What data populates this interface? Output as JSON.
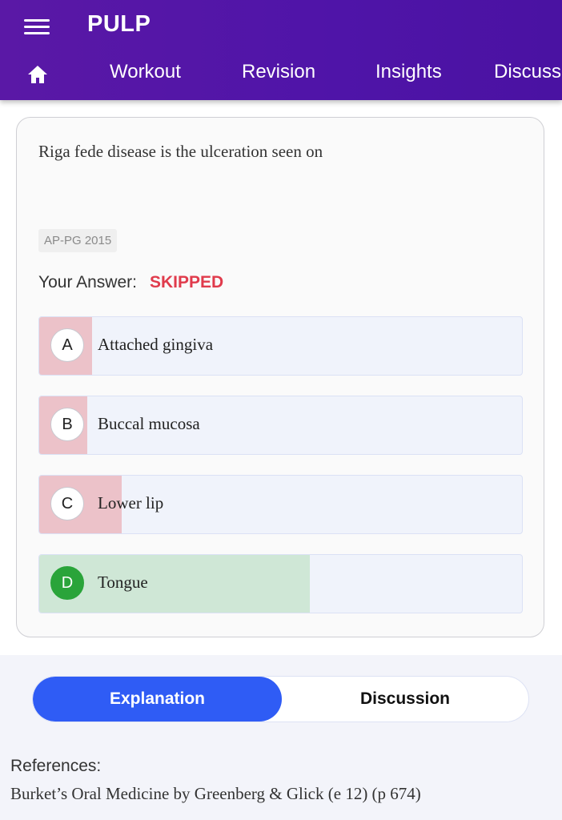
{
  "app": {
    "title": "PULP"
  },
  "nav": {
    "home_icon": "home-icon",
    "items": [
      {
        "label": "Workout"
      },
      {
        "label": "Revision"
      },
      {
        "label": "Insights"
      },
      {
        "label": "Discussion"
      }
    ]
  },
  "question": {
    "text": "Riga fede disease is the ulceration seen on",
    "tag": "AP-PG 2015",
    "your_answer_label": "Your Answer:",
    "your_answer_value": "SKIPPED",
    "options": [
      {
        "letter": "A",
        "text": "Attached gingiva",
        "response_share": 0.11,
        "state": "incorrect"
      },
      {
        "letter": "B",
        "text": "Buccal mucosa",
        "response_share": 0.1,
        "state": "incorrect"
      },
      {
        "letter": "C",
        "text": "Lower lip",
        "response_share": 0.17,
        "state": "incorrect"
      },
      {
        "letter": "D",
        "text": "Tongue",
        "response_share": 0.56,
        "state": "correct"
      }
    ]
  },
  "tabs": {
    "explanation": "Explanation",
    "discussion": "Discussion",
    "active": "Explanation"
  },
  "references": {
    "title": "References:",
    "text": "Burket’s Oral Medicine by Greenberg & Glick (e 12) (p 674)"
  },
  "colors": {
    "header": "#5416a8",
    "incorrect_fill": "#ecc2c9",
    "correct_fill": "#cfe7d6",
    "correct_circle": "#2aa43a",
    "skipped": "#e03b4c",
    "tab_active": "#2f5cf5"
  }
}
